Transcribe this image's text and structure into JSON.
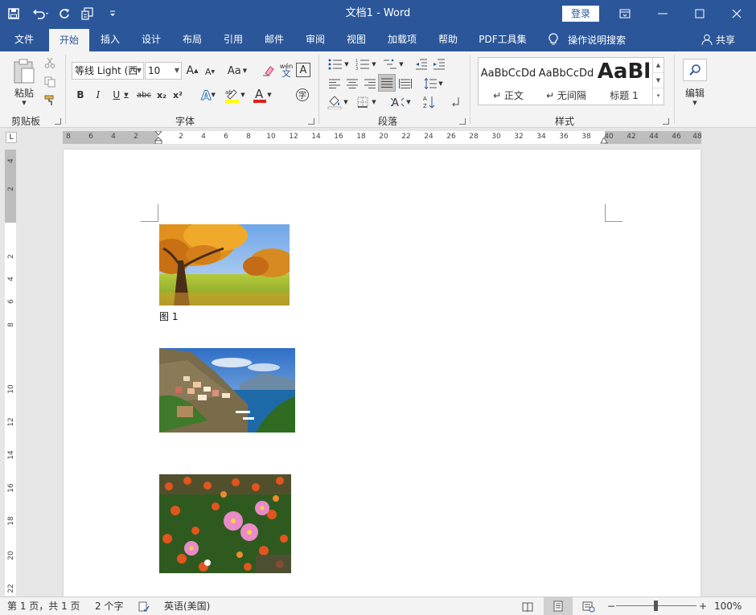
{
  "window": {
    "title": "文档1  -  Word",
    "login": "登录"
  },
  "tabs": [
    {
      "label": "文件"
    },
    {
      "label": "开始"
    },
    {
      "label": "插入"
    },
    {
      "label": "设计"
    },
    {
      "label": "布局"
    },
    {
      "label": "引用"
    },
    {
      "label": "邮件"
    },
    {
      "label": "审阅"
    },
    {
      "label": "视图"
    },
    {
      "label": "加载项"
    },
    {
      "label": "帮助"
    },
    {
      "label": "PDF工具集"
    }
  ],
  "tell_me": "操作说明搜索",
  "share": "共享",
  "ribbon": {
    "clipboard": {
      "paste": "粘贴",
      "label": "剪贴板"
    },
    "font": {
      "font_name": "等线 Light (西",
      "font_size": "10",
      "label": "字体",
      "aa": "Aa",
      "wen": "wén",
      "bold": "B",
      "italic": "I",
      "underline": "U",
      "strike": "abc",
      "sub": "x₂",
      "sup": "x²",
      "A": "A",
      "big_a": "A",
      "small_a": "A"
    },
    "paragraph": {
      "label": "段落"
    },
    "styles": {
      "label": "样式",
      "items": [
        {
          "preview": "AaBbCcDd",
          "name": "↵ 正文"
        },
        {
          "preview": "AaBbCcDd",
          "name": "↵ 无间隔"
        },
        {
          "preview": "AaBl",
          "name": "标题 1"
        }
      ]
    },
    "editing": {
      "label": "编辑"
    }
  },
  "ruler": {
    "h_ticks": [
      "8",
      "6",
      "4",
      "2",
      "2",
      "4",
      "6",
      "8",
      "10",
      "12",
      "14",
      "16",
      "18",
      "20",
      "22",
      "24",
      "26",
      "28",
      "30",
      "32",
      "34",
      "36",
      "38",
      "40",
      "42",
      "44",
      "46",
      "48"
    ],
    "v_ticks": [
      "4",
      "2",
      "2",
      "4",
      "6",
      "8",
      "10",
      "12",
      "14",
      "16",
      "18",
      "20",
      "22"
    ],
    "tab_selector": "L"
  },
  "document": {
    "caption": "图  1"
  },
  "status": {
    "page": "第 1 页，共 1 页",
    "words": "2 个字",
    "language": "英语(美国)",
    "zoom": "100%"
  },
  "colors": {
    "accent": "#2b579a",
    "ribbon_bg": "#f3f3f3",
    "page_bg": "#ffffff",
    "canvas_bg": "#e6e6e6"
  }
}
